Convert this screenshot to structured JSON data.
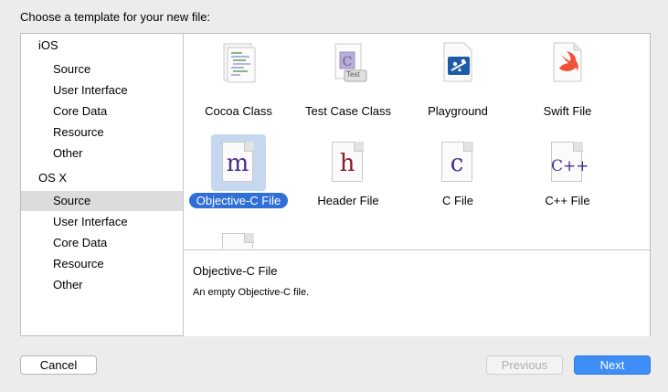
{
  "prompt": "Choose a template for your new file:",
  "sidebar": {
    "groups": [
      {
        "title": "iOS",
        "items": [
          "Source",
          "User Interface",
          "Core Data",
          "Resource",
          "Other"
        ]
      },
      {
        "title": "OS X",
        "items": [
          "Source",
          "User Interface",
          "Core Data",
          "Resource",
          "Other"
        ]
      }
    ],
    "selected": "OS X / Source"
  },
  "templates": [
    {
      "label": "Cocoa Class",
      "icon": "cocoa-class-icon"
    },
    {
      "label": "Test Case Class",
      "icon": "test-case-class-icon",
      "badge": "Test"
    },
    {
      "label": "Playground",
      "icon": "playground-icon"
    },
    {
      "label": "Swift File",
      "icon": "swift-file-icon"
    },
    {
      "label": "Objective-C File",
      "icon": "objective-c-file-icon",
      "letter": "m",
      "selected": true
    },
    {
      "label": "Header File",
      "icon": "header-file-icon",
      "letter": "h"
    },
    {
      "label": "C File",
      "icon": "c-file-icon",
      "letter": "c"
    },
    {
      "label": "C++ File",
      "icon": "cpp-file-icon",
      "letter": "C++"
    }
  ],
  "description": {
    "title": "Objective-C File",
    "text": "An empty Objective-C file."
  },
  "buttons": {
    "cancel": "Cancel",
    "previous": "Previous",
    "next": "Next"
  },
  "colors": {
    "accent": "#2f6fd6",
    "next_button": "#3d8ef6",
    "objc_letter": "#4b2d8c",
    "header_letter": "#8e1c2c",
    "c_letter": "#4b2d8c",
    "swift_orange": "#f05138",
    "playground_blue": "#1d5ba8"
  }
}
